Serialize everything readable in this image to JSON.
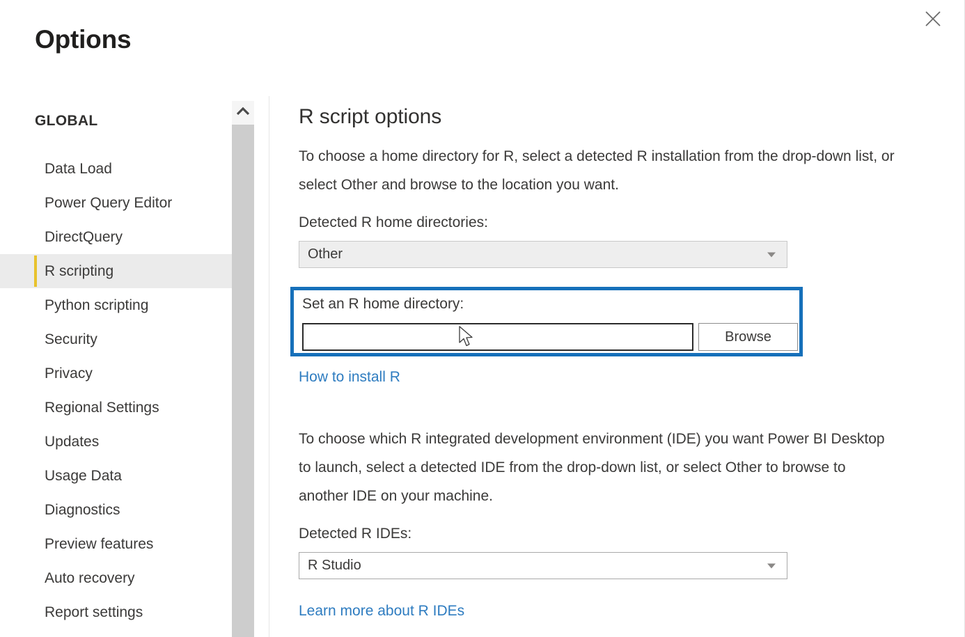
{
  "window": {
    "title": "Options",
    "close_icon": "close-icon"
  },
  "sidebar": {
    "header": "GLOBAL",
    "scroll_up_icon": "chevron-up-icon",
    "items": [
      {
        "label": "Data Load",
        "selected": false
      },
      {
        "label": "Power Query Editor",
        "selected": false
      },
      {
        "label": "DirectQuery",
        "selected": false
      },
      {
        "label": "R scripting",
        "selected": true
      },
      {
        "label": "Python scripting",
        "selected": false
      },
      {
        "label": "Security",
        "selected": false
      },
      {
        "label": "Privacy",
        "selected": false
      },
      {
        "label": "Regional Settings",
        "selected": false
      },
      {
        "label": "Updates",
        "selected": false
      },
      {
        "label": "Usage Data",
        "selected": false
      },
      {
        "label": "Diagnostics",
        "selected": false
      },
      {
        "label": "Preview features",
        "selected": false
      },
      {
        "label": "Auto recovery",
        "selected": false
      },
      {
        "label": "Report settings",
        "selected": false
      }
    ]
  },
  "content": {
    "section_title": "R script options",
    "paragraph_home": "To choose a home directory for R, select a detected R installation from the drop-down list, or select Other and browse to the location you want.",
    "label_detected_home_dirs": "Detected R home directories:",
    "dropdown_home_dirs_value": "Other",
    "highlight": {
      "label_set_home_dir": "Set an R home directory:",
      "input_value": "",
      "input_placeholder": "",
      "browse_label": "Browse"
    },
    "link_how_to_install": "How to install R",
    "paragraph_ide": "To choose which R integrated development environment (IDE) you want Power BI Desktop to launch, select a detected IDE from the drop-down list, or select Other to browse to another IDE on your machine.",
    "label_detected_ides": "Detected R IDEs:",
    "dropdown_ides_value": "R Studio",
    "link_learn_more_ides": "Learn more about R IDEs"
  },
  "colors": {
    "selection_accent": "#e8c22d",
    "selection_background": "#ebebeb",
    "link": "#2e7cc0",
    "highlight_border": "#1670ba",
    "scrollbar_thumb": "#cdcdcd"
  }
}
